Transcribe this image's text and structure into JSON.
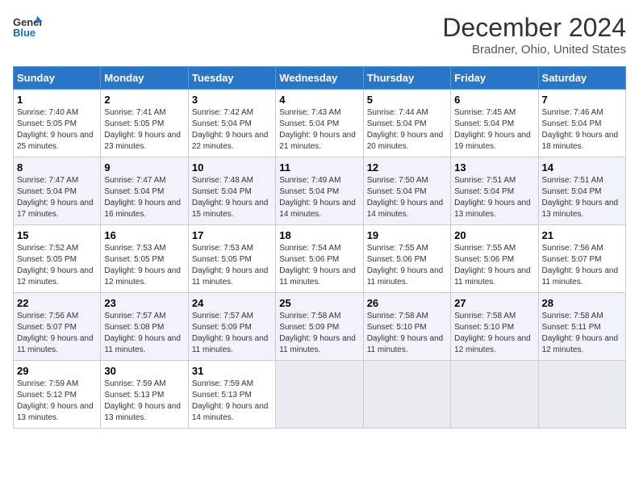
{
  "logo": {
    "line1": "General",
    "line2": "Blue"
  },
  "title": "December 2024",
  "subtitle": "Bradner, Ohio, United States",
  "days_of_week": [
    "Sunday",
    "Monday",
    "Tuesday",
    "Wednesday",
    "Thursday",
    "Friday",
    "Saturday"
  ],
  "weeks": [
    [
      {
        "day": 1,
        "sunrise": "7:40 AM",
        "sunset": "5:05 PM",
        "daylight": "9 hours and 25 minutes."
      },
      {
        "day": 2,
        "sunrise": "7:41 AM",
        "sunset": "5:05 PM",
        "daylight": "9 hours and 23 minutes."
      },
      {
        "day": 3,
        "sunrise": "7:42 AM",
        "sunset": "5:04 PM",
        "daylight": "9 hours and 22 minutes."
      },
      {
        "day": 4,
        "sunrise": "7:43 AM",
        "sunset": "5:04 PM",
        "daylight": "9 hours and 21 minutes."
      },
      {
        "day": 5,
        "sunrise": "7:44 AM",
        "sunset": "5:04 PM",
        "daylight": "9 hours and 20 minutes."
      },
      {
        "day": 6,
        "sunrise": "7:45 AM",
        "sunset": "5:04 PM",
        "daylight": "9 hours and 19 minutes."
      },
      {
        "day": 7,
        "sunrise": "7:46 AM",
        "sunset": "5:04 PM",
        "daylight": "9 hours and 18 minutes."
      }
    ],
    [
      {
        "day": 8,
        "sunrise": "7:47 AM",
        "sunset": "5:04 PM",
        "daylight": "9 hours and 17 minutes."
      },
      {
        "day": 9,
        "sunrise": "7:47 AM",
        "sunset": "5:04 PM",
        "daylight": "9 hours and 16 minutes."
      },
      {
        "day": 10,
        "sunrise": "7:48 AM",
        "sunset": "5:04 PM",
        "daylight": "9 hours and 15 minutes."
      },
      {
        "day": 11,
        "sunrise": "7:49 AM",
        "sunset": "5:04 PM",
        "daylight": "9 hours and 14 minutes."
      },
      {
        "day": 12,
        "sunrise": "7:50 AM",
        "sunset": "5:04 PM",
        "daylight": "9 hours and 14 minutes."
      },
      {
        "day": 13,
        "sunrise": "7:51 AM",
        "sunset": "5:04 PM",
        "daylight": "9 hours and 13 minutes."
      },
      {
        "day": 14,
        "sunrise": "7:51 AM",
        "sunset": "5:04 PM",
        "daylight": "9 hours and 13 minutes."
      }
    ],
    [
      {
        "day": 15,
        "sunrise": "7:52 AM",
        "sunset": "5:05 PM",
        "daylight": "9 hours and 12 minutes."
      },
      {
        "day": 16,
        "sunrise": "7:53 AM",
        "sunset": "5:05 PM",
        "daylight": "9 hours and 12 minutes."
      },
      {
        "day": 17,
        "sunrise": "7:53 AM",
        "sunset": "5:05 PM",
        "daylight": "9 hours and 11 minutes."
      },
      {
        "day": 18,
        "sunrise": "7:54 AM",
        "sunset": "5:06 PM",
        "daylight": "9 hours and 11 minutes."
      },
      {
        "day": 19,
        "sunrise": "7:55 AM",
        "sunset": "5:06 PM",
        "daylight": "9 hours and 11 minutes."
      },
      {
        "day": 20,
        "sunrise": "7:55 AM",
        "sunset": "5:06 PM",
        "daylight": "9 hours and 11 minutes."
      },
      {
        "day": 21,
        "sunrise": "7:56 AM",
        "sunset": "5:07 PM",
        "daylight": "9 hours and 11 minutes."
      }
    ],
    [
      {
        "day": 22,
        "sunrise": "7:56 AM",
        "sunset": "5:07 PM",
        "daylight": "9 hours and 11 minutes."
      },
      {
        "day": 23,
        "sunrise": "7:57 AM",
        "sunset": "5:08 PM",
        "daylight": "9 hours and 11 minutes."
      },
      {
        "day": 24,
        "sunrise": "7:57 AM",
        "sunset": "5:09 PM",
        "daylight": "9 hours and 11 minutes."
      },
      {
        "day": 25,
        "sunrise": "7:58 AM",
        "sunset": "5:09 PM",
        "daylight": "9 hours and 11 minutes."
      },
      {
        "day": 26,
        "sunrise": "7:58 AM",
        "sunset": "5:10 PM",
        "daylight": "9 hours and 11 minutes."
      },
      {
        "day": 27,
        "sunrise": "7:58 AM",
        "sunset": "5:10 PM",
        "daylight": "9 hours and 12 minutes."
      },
      {
        "day": 28,
        "sunrise": "7:58 AM",
        "sunset": "5:11 PM",
        "daylight": "9 hours and 12 minutes."
      }
    ],
    [
      {
        "day": 29,
        "sunrise": "7:59 AM",
        "sunset": "5:12 PM",
        "daylight": "9 hours and 13 minutes."
      },
      {
        "day": 30,
        "sunrise": "7:59 AM",
        "sunset": "5:13 PM",
        "daylight": "9 hours and 13 minutes."
      },
      {
        "day": 31,
        "sunrise": "7:59 AM",
        "sunset": "5:13 PM",
        "daylight": "9 hours and 14 minutes."
      },
      null,
      null,
      null,
      null
    ]
  ]
}
